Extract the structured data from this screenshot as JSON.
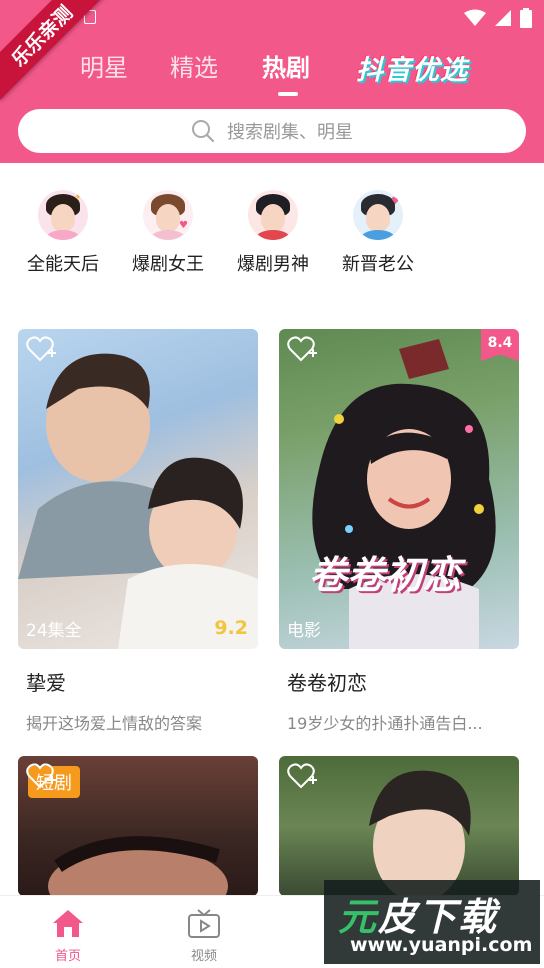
{
  "ribbon": {
    "text": "乐乐亲测"
  },
  "tabs": [
    {
      "label": "明星",
      "active": false
    },
    {
      "label": "精选",
      "active": false
    },
    {
      "label": "热剧",
      "active": true
    }
  ],
  "douyin_tab": {
    "label": "抖音优选"
  },
  "search": {
    "placeholder": "搜索剧集、明星"
  },
  "stars": [
    {
      "label": "全能天后"
    },
    {
      "label": "爆剧女王"
    },
    {
      "label": "爆剧男神"
    },
    {
      "label": "新晋老公"
    }
  ],
  "cards": [
    {
      "title": "挚爱",
      "desc": "揭开这场爱上情敌的答案",
      "episodes": "24集全",
      "score": "9.2"
    },
    {
      "title": "卷卷初恋",
      "desc": "19岁少女的扑通扑通告白...",
      "category": "电影",
      "score": "8.4",
      "poster_text": "卷卷初恋"
    },
    {
      "badge": "短剧"
    },
    {}
  ],
  "nav": [
    {
      "label": "首页",
      "active": true
    },
    {
      "label": "视频",
      "active": false
    }
  ],
  "watermark": {
    "brand_a": "元",
    "brand_b": "皮下载",
    "url": "www.yuanpi.com"
  },
  "colors": {
    "brand_pink": "#f2588a",
    "score_gold": "#f2c53d",
    "badge_orange": "#f59a1c"
  }
}
